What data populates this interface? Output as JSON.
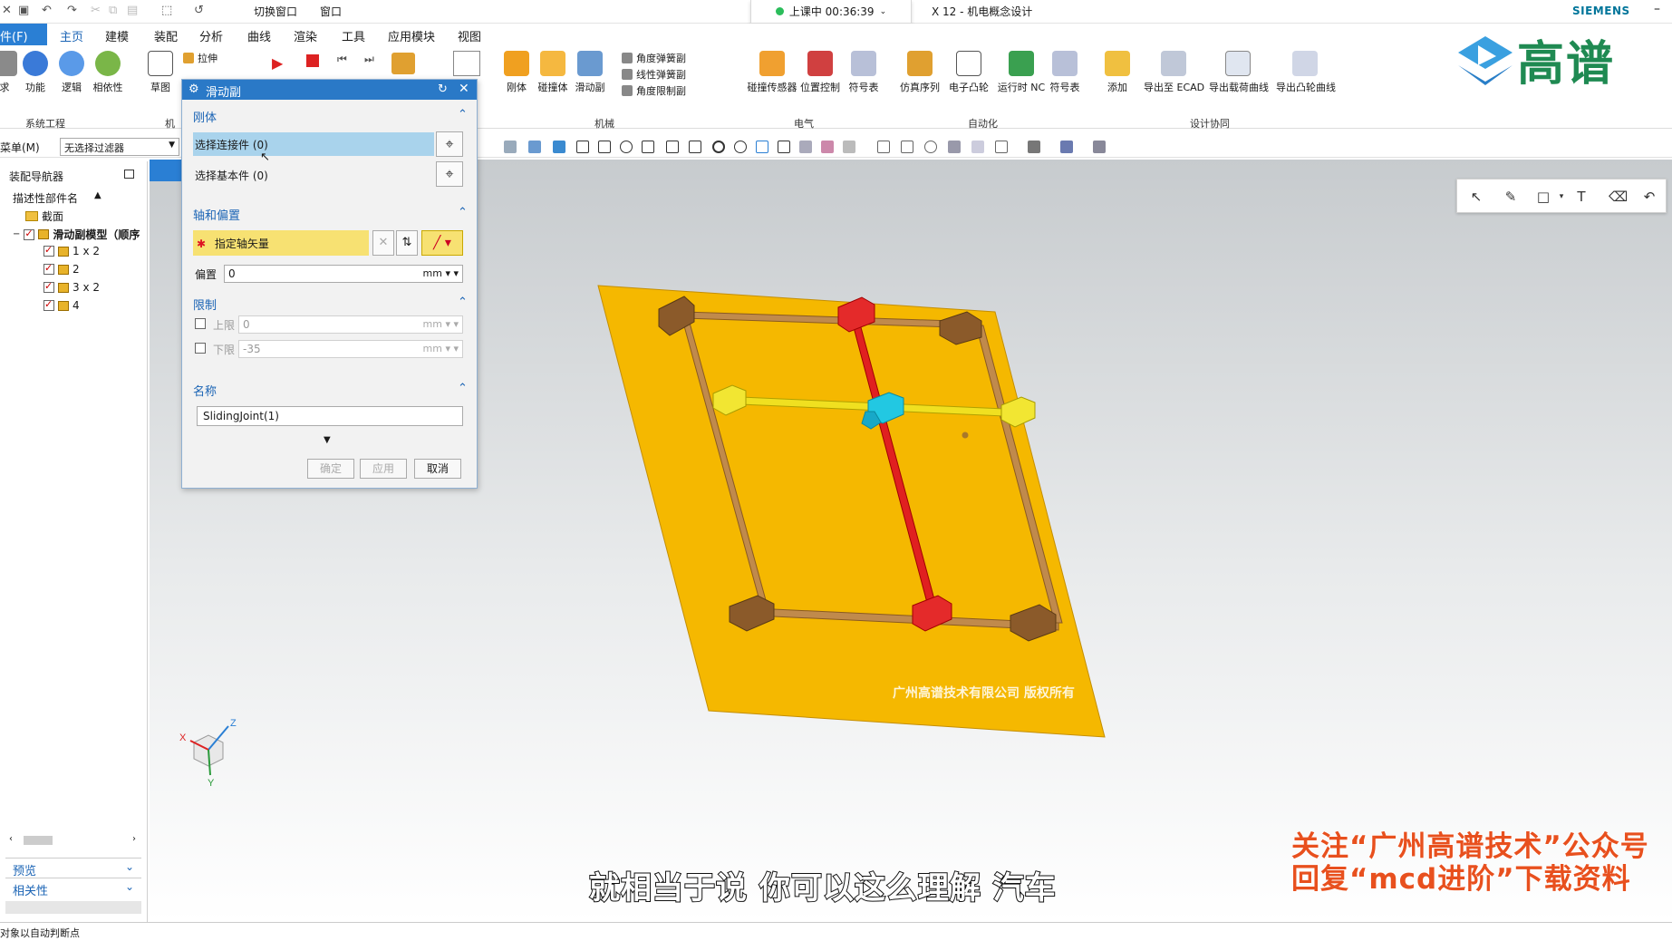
{
  "titlebar": {
    "switch_window": "切换窗口",
    "window_menu": "窗口",
    "timer_text": "上课中 00:36:39",
    "app_title": "X 12 - 机电概念设计",
    "brand": "SIEMENS",
    "minimize": "–"
  },
  "menu": {
    "file": "件(F)",
    "tabs": [
      "主页",
      "建模",
      "装配",
      "分析",
      "曲线",
      "渲染",
      "工具",
      "应用模块",
      "视图"
    ],
    "active_tab": "主页"
  },
  "ribbon": {
    "left_buttons": [
      "功能",
      "逻辑",
      "相依性",
      "草图"
    ],
    "left_partial": "求",
    "small_buttons": [
      "拉伸",
      "角度弹簧副",
      "线性弹簧副",
      "角度限制副"
    ],
    "mech_buttons": [
      "刚体",
      "碰撞体",
      "滑动副"
    ],
    "elec_buttons": [
      "碰撞传感器",
      "位置控制",
      "符号表"
    ],
    "auto_buttons": [
      "仿真序列",
      "电子凸轮",
      "运行时 NC",
      "符号表"
    ],
    "design_buttons": [
      "添加",
      "导出至 ECAD",
      "导出载荷曲线",
      "导出凸轮曲线"
    ],
    "groups": [
      "系统工程",
      "机械",
      "电气",
      "自动化",
      "设计协同"
    ],
    "group_partial": "机"
  },
  "toolbar2": {
    "menu": "菜单(M)",
    "filter": "无选择过滤器"
  },
  "navigator": {
    "title": "装配导航器",
    "column_header": "描述性部件名",
    "items": [
      {
        "label": "截面",
        "checked": false,
        "icon": "folder-icon"
      },
      {
        "label": "滑动副模型（顺序",
        "checked": true,
        "icon": "assembly-icon"
      },
      {
        "label": "1 x 2",
        "checked": true,
        "icon": "part-icon"
      },
      {
        "label": "2",
        "checked": true,
        "icon": "part-icon"
      },
      {
        "label": "3 x 2",
        "checked": true,
        "icon": "part-icon"
      },
      {
        "label": "4",
        "checked": true,
        "icon": "part-icon"
      }
    ],
    "preview": "预览",
    "relevance": "相关性"
  },
  "dialog": {
    "title": "滑动副",
    "section_rigid": "刚体",
    "select_connector": "选择连接件 (0)",
    "select_base": "选择基本件 (0)",
    "section_axis": "轴和偏置",
    "specify_vector": "指定轴矢量",
    "offset_label": "偏置",
    "offset_value": "0",
    "offset_unit": "mm",
    "section_limit": "限制",
    "upper_label": "上限",
    "upper_value": "0",
    "upper_unit": "mm",
    "lower_label": "下限",
    "lower_value": "-35",
    "lower_unit": "mm",
    "section_name": "名称",
    "name_value": "SlidingJoint(1)",
    "ok": "确定",
    "apply": "应用",
    "cancel": "取消"
  },
  "overlay": {
    "logo_text": "高谱",
    "watermark": "广州高谱技术有限公司 版权所有",
    "subtitle": "就相当于说 你可以这么理解 汽车",
    "promo_line1": "关注“广州高谱技术”公众号",
    "promo_line2": "回复“mcd进阶”下载资料"
  },
  "triad": {
    "x": "X",
    "y": "Y",
    "z": "Z"
  },
  "statusbar": {
    "text": "对象以自动判断点"
  },
  "colors": {
    "accent": "#2a7fd4",
    "plate": "#f5b800",
    "rail": "#b07a3a",
    "red_slider": "#e02020",
    "yellow_slider": "#f0e020",
    "cyan_block": "#20c8e0"
  }
}
